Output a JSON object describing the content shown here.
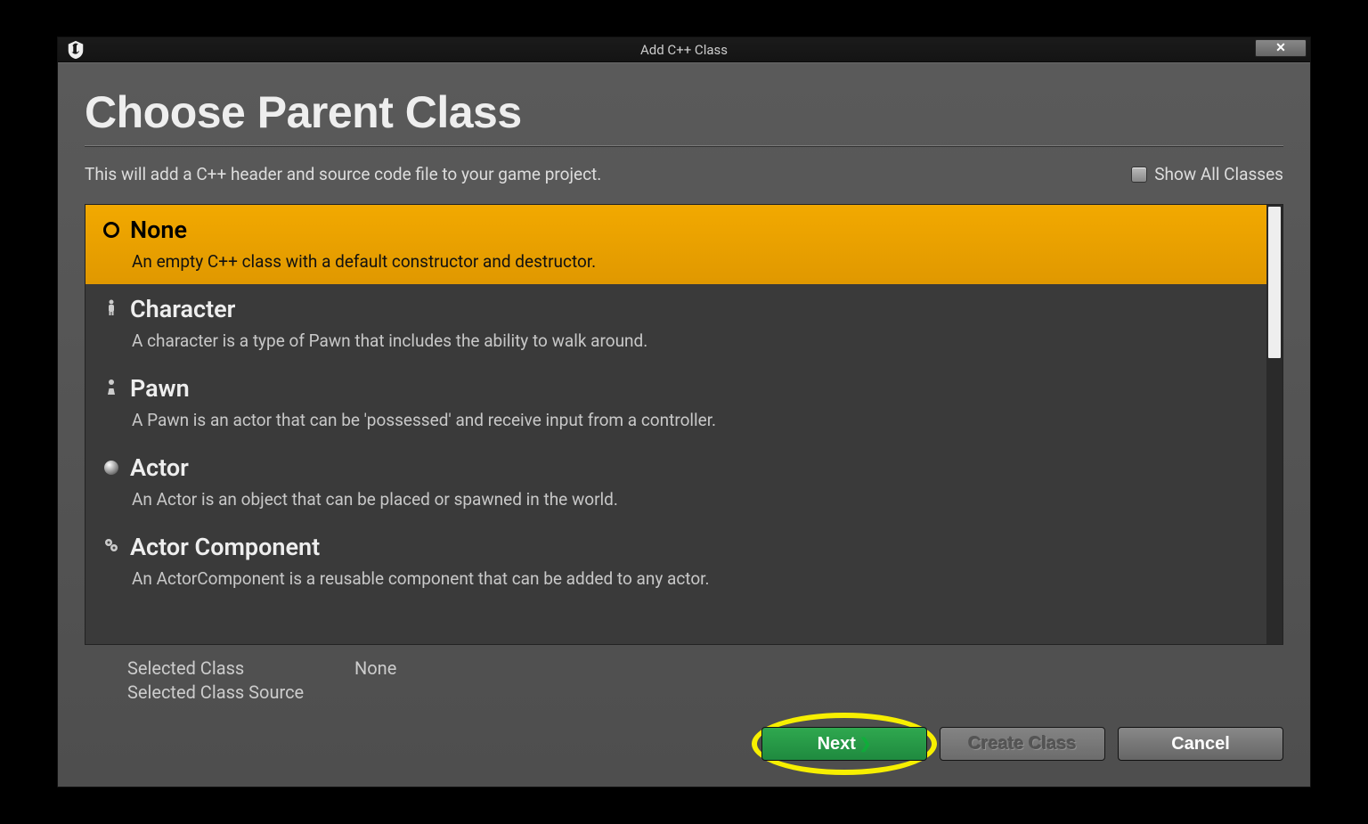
{
  "window": {
    "title": "Add C++ Class",
    "close_glyph": "✕"
  },
  "page": {
    "heading": "Choose Parent Class",
    "subtitle": "This will add a C++ header and source code file to your game project.",
    "show_all_label": "Show All Classes"
  },
  "classes": [
    {
      "name": "None",
      "desc": "An empty C++ class with a default constructor and destructor.",
      "icon": "none",
      "selected": true
    },
    {
      "name": "Character",
      "desc": "A character is a type of Pawn that includes the ability to walk around.",
      "icon": "character",
      "selected": false
    },
    {
      "name": "Pawn",
      "desc": "A Pawn is an actor that can be 'possessed' and receive input from a controller.",
      "icon": "pawn",
      "selected": false
    },
    {
      "name": "Actor",
      "desc": "An Actor is an object that can be placed or spawned in the world.",
      "icon": "actor",
      "selected": false
    },
    {
      "name": "Actor Component",
      "desc": "An ActorComponent is a reusable component that can be added to any actor.",
      "icon": "component",
      "selected": false
    }
  ],
  "status": {
    "selected_class_label": "Selected Class",
    "selected_class_value": "None",
    "selected_source_label": "Selected Class Source",
    "selected_source_value": ""
  },
  "buttons": {
    "next": "Next",
    "create": "Create Class",
    "cancel": "Cancel"
  }
}
